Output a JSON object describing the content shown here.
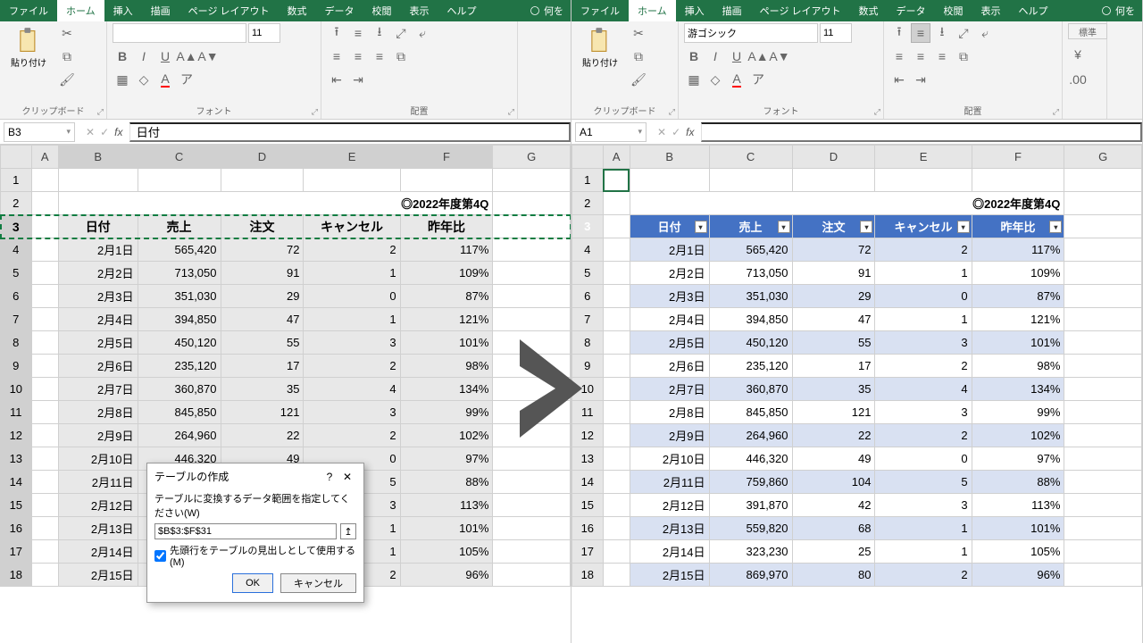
{
  "menu": {
    "tabs": [
      "ファイル",
      "ホーム",
      "挿入",
      "描画",
      "ページ レイアウト",
      "数式",
      "データ",
      "校閲",
      "表示",
      "ヘルプ"
    ],
    "active": "ホーム",
    "tellme": "何を"
  },
  "ribbon": {
    "clipboard": "クリップボード",
    "paste": "貼り付け",
    "font_group": "フォント",
    "align_group": "配置",
    "styles_group": "標準",
    "fontL": "",
    "fontsizeL": "11",
    "fontR": "游ゴシック",
    "fontsizeR": "11"
  },
  "left": {
    "namebox": "B3",
    "fx": "日付",
    "title": "◎2022年度第4Q",
    "headers": [
      "日付",
      "売上",
      "注文",
      "キャンセル",
      "昨年比"
    ]
  },
  "right": {
    "namebox": "A1",
    "fx": "",
    "title": "◎2022年度第4Q",
    "headers": [
      "日付",
      "売上",
      "注文",
      "キャンセル",
      "昨年比"
    ]
  },
  "dialog": {
    "title": "テーブルの作成",
    "msg": "テーブルに変換するデータ範囲を指定してください(W)",
    "range": "$B$3:$F$31",
    "check": "先頭行をテーブルの見出しとして使用する(M)",
    "ok": "OK",
    "cancel": "キャンセル"
  },
  "cols": [
    "",
    "A",
    "B",
    "C",
    "D",
    "E",
    "F",
    "G"
  ],
  "rows": [
    {
      "n": 1
    },
    {
      "n": 2,
      "title": true
    },
    {
      "n": 3,
      "hdr": true
    },
    {
      "n": 4,
      "d": [
        "2月1日",
        "565,420",
        "72",
        "2",
        "117%"
      ]
    },
    {
      "n": 5,
      "d": [
        "2月2日",
        "713,050",
        "91",
        "1",
        "109%"
      ]
    },
    {
      "n": 6,
      "d": [
        "2月3日",
        "351,030",
        "29",
        "0",
        "87%"
      ]
    },
    {
      "n": 7,
      "d": [
        "2月4日",
        "394,850",
        "47",
        "1",
        "121%"
      ]
    },
    {
      "n": 8,
      "d": [
        "2月5日",
        "450,120",
        "55",
        "3",
        "101%"
      ]
    },
    {
      "n": 9,
      "d": [
        "2月6日",
        "235,120",
        "17",
        "2",
        "98%"
      ]
    },
    {
      "n": 10,
      "d": [
        "2月7日",
        "360,870",
        "35",
        "4",
        "134%"
      ]
    },
    {
      "n": 11,
      "d": [
        "2月8日",
        "845,850",
        "121",
        "3",
        "99%"
      ]
    },
    {
      "n": 12,
      "d": [
        "2月9日",
        "264,960",
        "22",
        "2",
        "102%"
      ]
    },
    {
      "n": 13,
      "d": [
        "2月10日",
        "446,320",
        "49",
        "0",
        "97%"
      ]
    },
    {
      "n": 14,
      "d": [
        "2月11日",
        "759,860",
        "104",
        "5",
        "88%"
      ]
    },
    {
      "n": 15,
      "d": [
        "2月12日",
        "391,870",
        "42",
        "3",
        "113%"
      ]
    },
    {
      "n": 16,
      "d": [
        "2月13日",
        "559,820",
        "68",
        "1",
        "101%"
      ]
    },
    {
      "n": 17,
      "d": [
        "2月14日",
        "323,230",
        "25",
        "1",
        "105%"
      ]
    },
    {
      "n": 18,
      "d": [
        "2月15日",
        "869,970",
        "80",
        "2",
        "96%"
      ]
    }
  ]
}
